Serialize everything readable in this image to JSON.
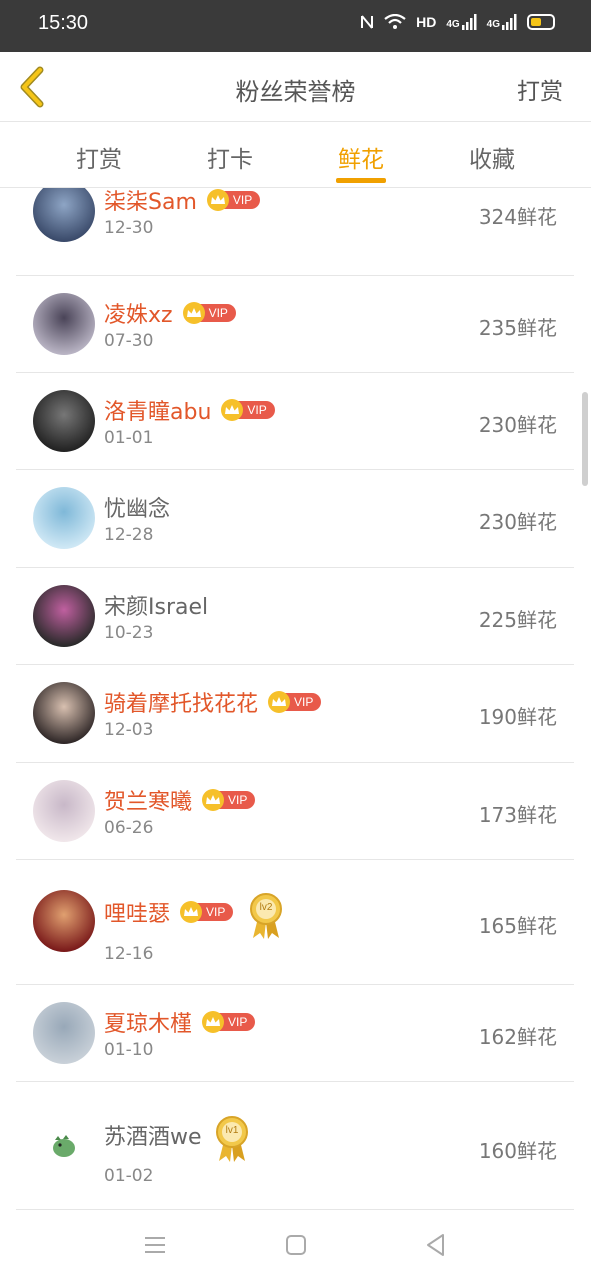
{
  "status": {
    "time": "15:30",
    "network": "HD",
    "signal1": "4G",
    "signal2": "4G"
  },
  "header": {
    "title": "粉丝荣誉榜",
    "action": "打赏"
  },
  "tabs": [
    {
      "label": "打赏"
    },
    {
      "label": "打卡"
    },
    {
      "label": "鲜花"
    },
    {
      "label": "收藏"
    }
  ],
  "active_tab": "鲜花",
  "vip_label": "VIP",
  "fans": [
    {
      "name": "柒柒Sam",
      "date": "12-30",
      "count": "324鲜花",
      "vip": true,
      "medal": ""
    },
    {
      "name": "凌姝xz",
      "date": "07-30",
      "count": "235鲜花",
      "vip": true,
      "medal": ""
    },
    {
      "name": "洛青瞳abu",
      "date": "01-01",
      "count": "230鲜花",
      "vip": true,
      "medal": ""
    },
    {
      "name": "忧幽念",
      "date": "12-28",
      "count": "230鲜花",
      "vip": false,
      "medal": ""
    },
    {
      "name": "宋颜Israel",
      "date": "10-23",
      "count": "225鲜花",
      "vip": false,
      "medal": ""
    },
    {
      "name": "骑着摩托找花花",
      "date": "12-03",
      "count": "190鲜花",
      "vip": true,
      "medal": ""
    },
    {
      "name": "贺兰寒曦",
      "date": "06-26",
      "count": "173鲜花",
      "vip": true,
      "medal": ""
    },
    {
      "name": "哩哇瑟",
      "date": "12-16",
      "count": "165鲜花",
      "vip": true,
      "medal": "lv2"
    },
    {
      "name": "夏琼木槿",
      "date": "01-10",
      "count": "162鲜花",
      "vip": true,
      "medal": ""
    },
    {
      "name": "苏酒酒we",
      "date": "01-02",
      "count": "160鲜花",
      "vip": false,
      "medal": "lv1"
    }
  ],
  "colors": {
    "accent": "#f0a000",
    "vip_name": "#e2572a",
    "vip_badge": "#e85a4a",
    "crown": "#f6c02a"
  }
}
